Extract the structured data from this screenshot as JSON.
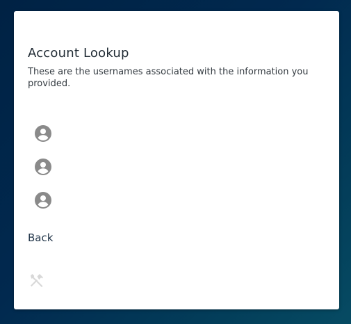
{
  "lookup": {
    "title": "Account Lookup",
    "subtitle": "These are the usernames associated with the information you provided.",
    "usernames": [
      "",
      "",
      ""
    ],
    "back_label": "Back"
  },
  "icons": {
    "user": "account-circle-icon",
    "tools": "tools-icon"
  },
  "colors": {
    "background": "#012a4f",
    "card": "#ffffff",
    "icon_gray": "#8a8a8a",
    "icon_light": "#d8d8d8",
    "text": "#1f2a33"
  }
}
